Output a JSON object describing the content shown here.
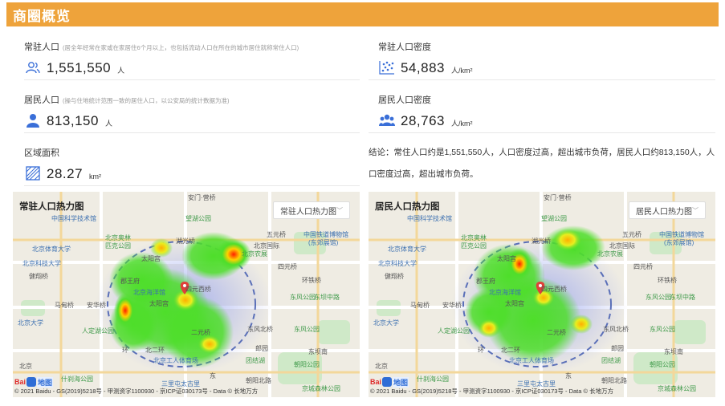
{
  "header": {
    "title": "商圈概览"
  },
  "stats": {
    "resident_pop": {
      "label": "常驻人口",
      "note": "(居全年经常在家或在家居住6个月以上，也包括流动人口在所在的城市居住就称常住人口)",
      "value": "1,551,550",
      "unit": "人",
      "icon": "users-outline-icon"
    },
    "resident_density": {
      "label": "常驻人口密度",
      "value": "54,883",
      "unit": "人/km²",
      "icon": "dots-density-icon"
    },
    "household_pop": {
      "label": "居民人口",
      "note": "(操与住地统计范围一致的居住人口，以公安局的统计数据为准)",
      "value": "813,150",
      "unit": "人",
      "icon": "user-filled-icon"
    },
    "household_density": {
      "label": "居民人口密度",
      "value": "28,763",
      "unit": "人/km²",
      "icon": "group-filled-icon"
    },
    "area": {
      "label": "区域面积",
      "value": "28.27",
      "unit": "km²",
      "icon": "area-hatch-icon"
    }
  },
  "conclusion": "结论：常住人口约是1,551,550人，人口密度过高，超出城市负荷，居民人口约813,150人，人口密度过高，超出城市负荷。",
  "maps": [
    {
      "title": "常驻人口热力图",
      "select_value": "常驻人口热力图",
      "copyright": "© 2021 Baidu - GS(2019)5218号 - 甲测资字1100930 - 京ICP证030173号 - Data © 长地万方"
    },
    {
      "title": "居民人口热力图",
      "select_value": "居民人口热力图",
      "copyright": "© 2021 Baidu - GS(2019)5218号 - 甲测资字1100930 - 京ICP证030173号 - Data © 长地万方"
    }
  ],
  "map_labels": {
    "l1": "安门·营桥",
    "l2": "中国科学技术馆",
    "l3": "望湖公园",
    "l4": "北京奥林",
    "l5": "匹克公园",
    "l6": "北京体育大学",
    "l7": "中国铁道博物馆",
    "l8": "(东郊展馆)",
    "l9": "北京科技大学",
    "l10": "北京国际",
    "l11": "健翔桥",
    "l12": "太阳宫",
    "l13": "湖光桥",
    "l14": "五元桥",
    "l15": "北京农展",
    "l16": "东风公园",
    "l17": "环铁桥",
    "l18": "四元西桥",
    "l19": "北京海洋馆",
    "l20": "太阳宫",
    "l21": "马甸桥",
    "l22": "安华桥",
    "l23": "东坝中路",
    "l24": "北京大学",
    "l25": "人定湖公园",
    "l26": "东风北桥",
    "l27": "东风公园",
    "l28": "二元桥",
    "l29": "北京工人体育场",
    "l30": "团结湖",
    "l31": "北二环",
    "l32": "朝阳公园",
    "l33": "郎园",
    "l34": "什刹海公园",
    "l35": "三里屯太古里",
    "l36": "京城森林公园",
    "l37": "朝阳北路",
    "l38": "北京",
    "l39": "四元桥",
    "l40": "东坝南",
    "l41": "郡王府",
    "l42": "环",
    "l43": "东",
    "logo_bai": "Bai",
    "logo_ditu": "地图"
  }
}
